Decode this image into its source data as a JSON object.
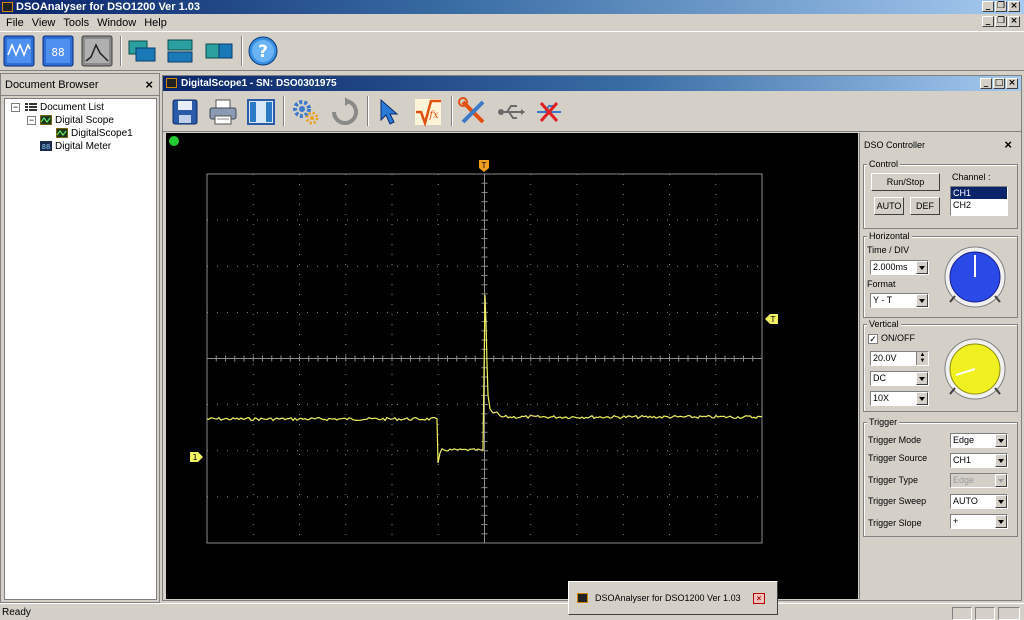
{
  "app": {
    "title": "DSOAnalyser for DSO1200 Ver 1.03"
  },
  "menu": [
    "File",
    "View",
    "Tools",
    "Window",
    "Help"
  ],
  "toolbar_icons": [
    "scope-mode-icon",
    "meter-mode-icon",
    "spectrum-mode-icon",
    "cascade-windows-icon",
    "tile-horizontal-icon",
    "tile-vertical-icon",
    "help-icon"
  ],
  "doc_browser": {
    "title": "Document Browser",
    "tree": {
      "root": "Document List",
      "scope": "Digital Scope",
      "scope_child": "DigitalScope1",
      "meter": "Digital Meter"
    }
  },
  "child_window": {
    "title": "DigitalScope1 - SN: DSO0301975",
    "toolbar_icons": [
      "save-icon",
      "print-icon",
      "layout-icon",
      "settings-gear-icon",
      "refresh-icon",
      "pointer-icon",
      "math-function-icon",
      "tools-icon",
      "usb-connect-icon",
      "usb-disconnect-icon"
    ]
  },
  "scope": {
    "trigger_pos_marker": "T",
    "trigger_level_marker": "T",
    "ch1_marker": "1",
    "colors": {
      "trace": "#f0f060",
      "grid": "#8c8c8c",
      "background": "#000000",
      "status_led": "#22cc33"
    }
  },
  "controller": {
    "title": "DSO Controller",
    "control": {
      "label": "Control",
      "run_stop": "Run/Stop",
      "auto": "AUTO",
      "def": "DEF",
      "channel_label": "Channel :",
      "channels": [
        "CH1",
        "CH2"
      ],
      "selected_channel": "CH1"
    },
    "horizontal": {
      "label": "Horizontal",
      "time_div_label": "Time / DIV",
      "time_div": "2.000ms",
      "format_label": "Format",
      "format": "Y - T"
    },
    "vertical": {
      "label": "Vertical",
      "onoff_label": "ON/OFF",
      "onoff_checked": true,
      "volts": "20.0V",
      "coupling": "DC",
      "probe": "10X"
    },
    "trigger": {
      "label": "Trigger",
      "mode_label": "Trigger Mode",
      "mode": "Edge",
      "source_label": "Trigger Source",
      "source": "CH1",
      "type_label": "Trigger Type",
      "type": "Edge",
      "sweep_label": "Trigger Sweep",
      "sweep": "AUTO",
      "slope_label": "Trigger Slope",
      "slope": "+"
    }
  },
  "status": {
    "text": "Ready"
  },
  "taskbar_popup": {
    "text": "DSOAnalyser for DSO1200 Ver 1.03"
  }
}
